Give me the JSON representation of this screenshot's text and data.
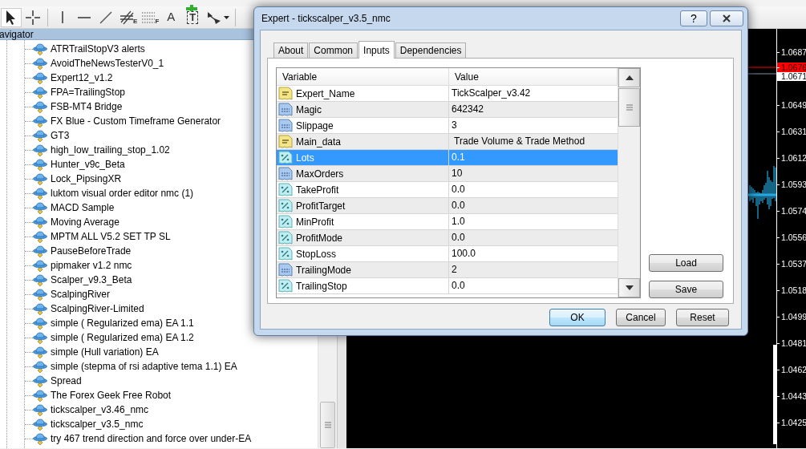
{
  "toolbar": {
    "tools": [
      {
        "kind": "cursor",
        "selected": true
      },
      {
        "kind": "crosshair",
        "selected": false
      },
      {
        "kind": "separator"
      },
      {
        "kind": "vline",
        "selected": false
      },
      {
        "kind": "hline",
        "selected": false
      },
      {
        "kind": "trendline",
        "selected": false
      },
      {
        "kind": "fibo",
        "glyph": "E",
        "selected": false
      },
      {
        "kind": "grid",
        "glyph": "F",
        "selected": false
      },
      {
        "kind": "text",
        "glyph": "A",
        "selected": false
      },
      {
        "kind": "label",
        "glyph": "T",
        "selected": false
      },
      {
        "kind": "arrows",
        "selected": false
      },
      {
        "kind": "separator"
      }
    ]
  },
  "navigator": {
    "title": "avigator",
    "items": [
      {
        "label": "ATRTrailStopV3 alerts"
      },
      {
        "label": "AvoidTheNewsTesterV0_1"
      },
      {
        "label": "Expert12_v1.2"
      },
      {
        "label": "FPA=TrailingStop"
      },
      {
        "label": "FSB-MT4 Bridge"
      },
      {
        "label": "FX Blue - Custom Timeframe Generator"
      },
      {
        "label": "GT3"
      },
      {
        "label": "high_low_trailing_stop_1.02"
      },
      {
        "label": "Hunter_v9c_Beta"
      },
      {
        "label": "Lock_PipsingXR"
      },
      {
        "label": "luktom visual order editor nmc (1)"
      },
      {
        "label": "MACD Sample"
      },
      {
        "label": "Moving Average"
      },
      {
        "label": "MPTM ALL V5.2 SET TP SL"
      },
      {
        "label": "PauseBeforeTrade"
      },
      {
        "label": "pipmaker v1.2 nmc"
      },
      {
        "label": "Scalper_v9.3_Beta"
      },
      {
        "label": "ScalpingRiver"
      },
      {
        "label": "ScalpingRiver-Limited"
      },
      {
        "label": "simple ( Regularized ema) EA 1.1"
      },
      {
        "label": "simple ( Regularized ema) EA 1.2"
      },
      {
        "label": "simple (Hull variation) EA"
      },
      {
        "label": "simple (stepma of rsi adaptive tema 1.1) EA"
      },
      {
        "label": "Spread"
      },
      {
        "label": "The Forex Geek Free Robot"
      },
      {
        "label": "tickscalper_v3.46_nmc"
      },
      {
        "label": "tickscalper_v3.5_nmc"
      },
      {
        "label": "try 467 trend direction and force over under-EA"
      }
    ]
  },
  "chart": {
    "price_labels": [
      {
        "kind": "tick",
        "text": "1.0687"
      },
      {
        "kind": "bid",
        "text": "1.0676"
      },
      {
        "kind": "ask",
        "text": "1.0671"
      },
      {
        "kind": "tick",
        "text": "1.0649"
      },
      {
        "kind": "tick",
        "text": "1.0631"
      },
      {
        "kind": "tick",
        "text": "1.0612"
      },
      {
        "kind": "tick",
        "text": "1.0593"
      },
      {
        "kind": "tick",
        "text": "1.0574"
      },
      {
        "kind": "tick",
        "text": "1.0556"
      },
      {
        "kind": "tick",
        "text": "1.0537"
      },
      {
        "kind": "tick",
        "text": "1.0518"
      },
      {
        "kind": "tick",
        "text": "1.0499"
      },
      {
        "kind": "tick",
        "text": "1.0481"
      },
      {
        "kind": "tick",
        "text": "1.0462"
      },
      {
        "kind": "tick",
        "text": "1.0443"
      },
      {
        "kind": "tick",
        "text": "1.0425"
      }
    ]
  },
  "dialog": {
    "title": "Expert - tickscalper_v3.5_nmc",
    "help_glyph": "?",
    "tabs": [
      {
        "label": "About",
        "selected": false
      },
      {
        "label": "Common",
        "selected": false
      },
      {
        "label": "Inputs",
        "selected": true
      },
      {
        "label": "Dependencies",
        "selected": false
      }
    ],
    "inputs": {
      "columns": [
        "Variable",
        "Value"
      ],
      "rows": [
        {
          "kind": "string",
          "name": "Expert_Name",
          "value": "TickScalper_v3.42",
          "selected": false
        },
        {
          "kind": "int",
          "name": "Magic",
          "value": "642342",
          "selected": false
        },
        {
          "kind": "int",
          "name": "Slippage",
          "value": "3",
          "selected": false
        },
        {
          "kind": "string",
          "name": "Main_data",
          "value": " Trade Volume & Trade Method",
          "selected": false
        },
        {
          "kind": "double",
          "name": "Lots",
          "value": "0.1",
          "selected": true
        },
        {
          "kind": "int",
          "name": "MaxOrders",
          "value": "10",
          "selected": false
        },
        {
          "kind": "double",
          "name": "TakeProfit",
          "value": "0.0",
          "selected": false
        },
        {
          "kind": "double",
          "name": "ProfitTarget",
          "value": "0.0",
          "selected": false
        },
        {
          "kind": "double",
          "name": "MinProfit",
          "value": "1.0",
          "selected": false
        },
        {
          "kind": "double",
          "name": "ProfitMode",
          "value": "0.0",
          "selected": false
        },
        {
          "kind": "double",
          "name": "StopLoss",
          "value": "100.0",
          "selected": false
        },
        {
          "kind": "int",
          "name": "TrailingMode",
          "value": "2",
          "selected": false
        },
        {
          "kind": "double",
          "name": "TrailingStop",
          "value": "0.0",
          "selected": false
        }
      ]
    },
    "side_buttons": [
      "Load",
      "Save"
    ],
    "buttons": [
      {
        "label": "OK",
        "default": true
      },
      {
        "label": "Cancel",
        "default": false
      },
      {
        "label": "Reset",
        "default": false
      }
    ]
  }
}
